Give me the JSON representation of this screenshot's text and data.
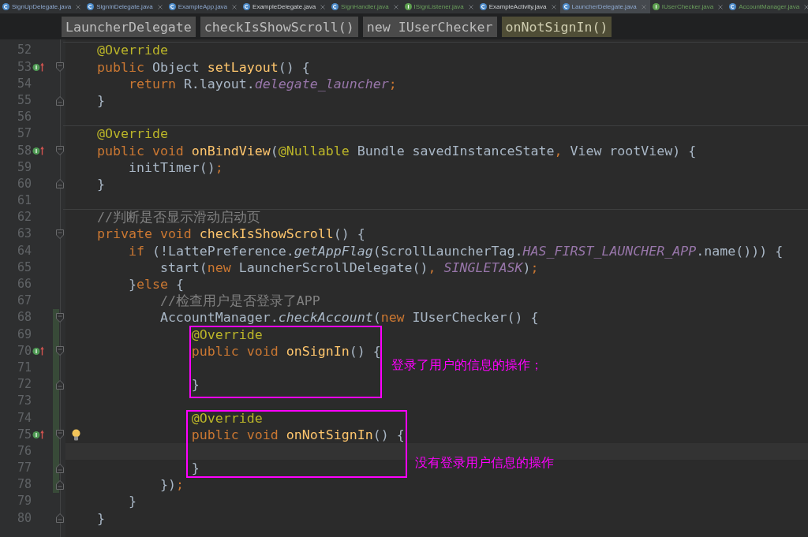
{
  "tabs": [
    {
      "label": "SignUpDelegate.java",
      "kind": "class",
      "modified": true,
      "added": false,
      "selected": false
    },
    {
      "label": "SignInDelegate.java",
      "kind": "class",
      "modified": true,
      "added": false,
      "selected": false
    },
    {
      "label": "ExampleApp.java",
      "kind": "class",
      "modified": true,
      "added": false,
      "selected": false
    },
    {
      "label": "ExampleDelegate.java",
      "kind": "class",
      "modified": false,
      "added": false,
      "selected": false
    },
    {
      "label": "SignHandler.java",
      "kind": "class",
      "modified": false,
      "added": true,
      "selected": false
    },
    {
      "label": "ISignListener.java",
      "kind": "interface",
      "modified": false,
      "added": true,
      "selected": false
    },
    {
      "label": "ExampleActivity.java",
      "kind": "class",
      "modified": false,
      "added": false,
      "selected": false
    },
    {
      "label": "LauncherDelegate.java",
      "kind": "class",
      "modified": true,
      "added": false,
      "selected": true
    },
    {
      "label": "IUserChecker.java",
      "kind": "interface",
      "modified": false,
      "added": true,
      "selected": false
    },
    {
      "label": "AccountManager.java",
      "kind": "class",
      "modified": false,
      "added": true,
      "selected": false
    }
  ],
  "breadcrumbs": [
    {
      "label": "LauncherDelegate",
      "selected": false
    },
    {
      "label": "checkIsShowScroll()",
      "selected": false
    },
    {
      "label": "new IUserChecker",
      "selected": false
    },
    {
      "label": "onNotSignIn()",
      "selected": true
    }
  ],
  "lines": [
    {
      "number": "52",
      "decorations": [
        {
          "kind": "separator"
        }
      ],
      "tokens": [
        {
          "kind": "annotation",
          "text": "    @Override"
        }
      ]
    },
    {
      "number": "53",
      "decorations": [
        {
          "kind": "override"
        },
        {
          "kind": "foldstart"
        }
      ],
      "tokens": [
        {
          "kind": "keyword",
          "text": "    public "
        },
        {
          "kind": "plain",
          "text": "Object "
        },
        {
          "kind": "declaration",
          "text": "setLayout"
        },
        {
          "kind": "plain",
          "text": "() {"
        }
      ]
    },
    {
      "number": "54",
      "tokens": [
        {
          "kind": "keyword",
          "text": "        return "
        },
        {
          "kind": "plain",
          "text": "R.layout."
        },
        {
          "kind": "constant",
          "text": "delegate_launcher"
        },
        {
          "kind": "keyword",
          "text": ";"
        }
      ]
    },
    {
      "number": "55",
      "decorations": [
        {
          "kind": "foldend"
        }
      ],
      "tokens": [
        {
          "kind": "plain",
          "text": "    }"
        }
      ]
    },
    {
      "number": "56"
    },
    {
      "number": "57",
      "decorations": [
        {
          "kind": "separator"
        }
      ],
      "tokens": [
        {
          "kind": "annotation",
          "text": "    @Override"
        }
      ]
    },
    {
      "number": "58",
      "decorations": [
        {
          "kind": "override"
        },
        {
          "kind": "foldstart"
        }
      ],
      "tokens": [
        {
          "kind": "keyword",
          "text": "    public void "
        },
        {
          "kind": "declaration",
          "text": "onBindView"
        },
        {
          "kind": "plain",
          "text": "("
        },
        {
          "kind": "annotation",
          "text": "@Nullable"
        },
        {
          "kind": "plain",
          "text": " Bundle savedInstanceState"
        },
        {
          "kind": "keyword",
          "text": ", "
        },
        {
          "kind": "plain",
          "text": "View rootView) {"
        }
      ]
    },
    {
      "number": "59",
      "tokens": [
        {
          "kind": "plain",
          "text": "        initTimer()"
        },
        {
          "kind": "keyword",
          "text": ";"
        }
      ]
    },
    {
      "number": "60",
      "decorations": [
        {
          "kind": "foldend"
        }
      ],
      "tokens": [
        {
          "kind": "plain",
          "text": "    }"
        }
      ]
    },
    {
      "number": "61"
    },
    {
      "number": "62",
      "decorations": [
        {
          "kind": "separator"
        }
      ],
      "tokens": [
        {
          "kind": "comment",
          "text": "    //判断是否显示滑动启动页"
        }
      ]
    },
    {
      "number": "63",
      "decorations": [
        {
          "kind": "foldstart"
        }
      ],
      "tokens": [
        {
          "kind": "keyword",
          "text": "    private void "
        },
        {
          "kind": "declaration",
          "text": "checkIsShowScroll"
        },
        {
          "kind": "plain",
          "text": "() {"
        }
      ]
    },
    {
      "number": "64",
      "tokens": [
        {
          "kind": "keyword",
          "text": "        if "
        },
        {
          "kind": "plain",
          "text": "(!LattePreference."
        },
        {
          "kind": "static",
          "text": "getAppFlag"
        },
        {
          "kind": "plain",
          "text": "(ScrollLauncherTag."
        },
        {
          "kind": "constant",
          "text": "HAS_FIRST_LAUNCHER_APP"
        },
        {
          "kind": "plain",
          "text": ".name())) {"
        }
      ]
    },
    {
      "number": "65",
      "tokens": [
        {
          "kind": "plain",
          "text": "            start("
        },
        {
          "kind": "keyword",
          "text": "new "
        },
        {
          "kind": "plain",
          "text": "LauncherScrollDelegate()"
        },
        {
          "kind": "keyword",
          "text": ", "
        },
        {
          "kind": "constant",
          "text": "SINGLETASK"
        },
        {
          "kind": "plain",
          "text": ")"
        },
        {
          "kind": "keyword",
          "text": ";"
        }
      ]
    },
    {
      "number": "66",
      "tokens": [
        {
          "kind": "plain",
          "text": "        }"
        },
        {
          "kind": "keyword",
          "text": "else "
        },
        {
          "kind": "plain",
          "text": "{"
        }
      ]
    },
    {
      "number": "67",
      "tokens": [
        {
          "kind": "comment",
          "text": "            //检查用户是否登录了APP"
        }
      ]
    },
    {
      "number": "68",
      "decorations": [
        {
          "kind": "changed"
        },
        {
          "kind": "foldstart"
        }
      ],
      "tokens": [
        {
          "kind": "plain",
          "text": "            AccountManager."
        },
        {
          "kind": "static",
          "text": "checkAccount"
        },
        {
          "kind": "plain",
          "text": "("
        },
        {
          "kind": "keyword",
          "text": "new "
        },
        {
          "kind": "plain",
          "text": "IUserChecker() {"
        }
      ]
    },
    {
      "number": "69",
      "decorations": [
        {
          "kind": "changed"
        }
      ],
      "tokens": [
        {
          "kind": "annotation",
          "text": "                @Override"
        }
      ]
    },
    {
      "number": "70",
      "decorations": [
        {
          "kind": "override"
        },
        {
          "kind": "changed"
        },
        {
          "kind": "foldstart"
        }
      ],
      "tokens": [
        {
          "kind": "keyword",
          "text": "                public void "
        },
        {
          "kind": "declaration",
          "text": "onSignIn"
        },
        {
          "kind": "plain",
          "text": "() {"
        }
      ]
    },
    {
      "number": "71",
      "decorations": [
        {
          "kind": "changed"
        }
      ]
    },
    {
      "number": "72",
      "decorations": [
        {
          "kind": "changed"
        },
        {
          "kind": "foldend"
        }
      ],
      "tokens": [
        {
          "kind": "plain",
          "text": "                }"
        }
      ]
    },
    {
      "number": "73",
      "decorations": [
        {
          "kind": "changed"
        }
      ]
    },
    {
      "number": "74",
      "decorations": [
        {
          "kind": "changed"
        }
      ],
      "tokens": [
        {
          "kind": "annotation",
          "text": "                @Override"
        }
      ]
    },
    {
      "number": "75",
      "decorations": [
        {
          "kind": "override"
        },
        {
          "kind": "changed"
        },
        {
          "kind": "foldstart"
        },
        {
          "kind": "bulb"
        }
      ],
      "tokens": [
        {
          "kind": "keyword",
          "text": "                public void "
        },
        {
          "kind": "declaration",
          "text": "onNotSignIn"
        },
        {
          "kind": "plain",
          "text": "() {"
        }
      ]
    },
    {
      "number": "76",
      "decorations": [
        {
          "kind": "changed"
        },
        {
          "kind": "caret"
        }
      ]
    },
    {
      "number": "77",
      "decorations": [
        {
          "kind": "changed"
        },
        {
          "kind": "foldend"
        }
      ],
      "tokens": [
        {
          "kind": "plain",
          "text": "                }"
        }
      ]
    },
    {
      "number": "78",
      "decorations": [
        {
          "kind": "changed"
        },
        {
          "kind": "foldend"
        }
      ],
      "tokens": [
        {
          "kind": "plain",
          "text": "            })"
        },
        {
          "kind": "keyword",
          "text": ";"
        }
      ]
    },
    {
      "number": "79",
      "tokens": [
        {
          "kind": "plain",
          "text": "        }"
        }
      ]
    },
    {
      "number": "80",
      "decorations": [
        {
          "kind": "foldend"
        }
      ],
      "tokens": [
        {
          "kind": "plain",
          "text": "    }"
        }
      ]
    }
  ],
  "annotations": [
    {
      "text": "登录了用户的信息的操作；"
    },
    {
      "text": "没有登录用户信息的操作"
    }
  ]
}
